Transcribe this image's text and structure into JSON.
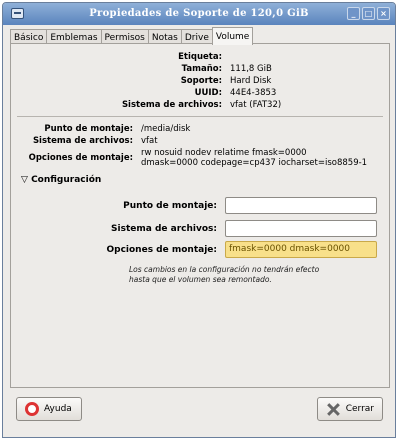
{
  "window": {
    "title": "Propiedades de Soporte de 120,0 GiB"
  },
  "tabs": [
    {
      "label": "Básico"
    },
    {
      "label": "Emblemas"
    },
    {
      "label": "Permisos"
    },
    {
      "label": "Notas"
    },
    {
      "label": "Drive"
    },
    {
      "label": "Volume"
    }
  ],
  "volume_info": {
    "etiqueta_label": "Etiqueta:",
    "etiqueta_value": "",
    "tamano_label": "Tamaño:",
    "tamano_value": "111,8 GiB",
    "soporte_label": "Soporte:",
    "soporte_value": "Hard Disk",
    "uuid_label": "UUID:",
    "uuid_value": "44E4-3853",
    "fs_label": "Sistema de archivos:",
    "fs_value": "vfat (FAT32)"
  },
  "mount_info": {
    "punto_label": "Punto de montaje:",
    "punto_value": "/media/disk",
    "fs_label": "Sistema de archivos:",
    "fs_value": "vfat",
    "opciones_label": "Opciones de montaje:",
    "opciones_value_line1": "rw nosuid nodev relatime fmask=0000",
    "opciones_value_line2": "dmask=0000 codepage=cp437 iocharset=iso8859-1"
  },
  "config": {
    "header": "Configuración",
    "punto_label": "Punto de montaje:",
    "punto_value": "",
    "fs_label": "Sistema de archivos:",
    "fs_value": "",
    "opciones_label": "Opciones de montaje:",
    "opciones_value": "fmask=0000 dmask=0000",
    "note_line1": "Los cambios en la configuración no tendrán efecto",
    "note_line2": "hasta que el volumen sea remontado."
  },
  "buttons": {
    "help_label": "Ayuda",
    "close_label": "Cerrar"
  }
}
